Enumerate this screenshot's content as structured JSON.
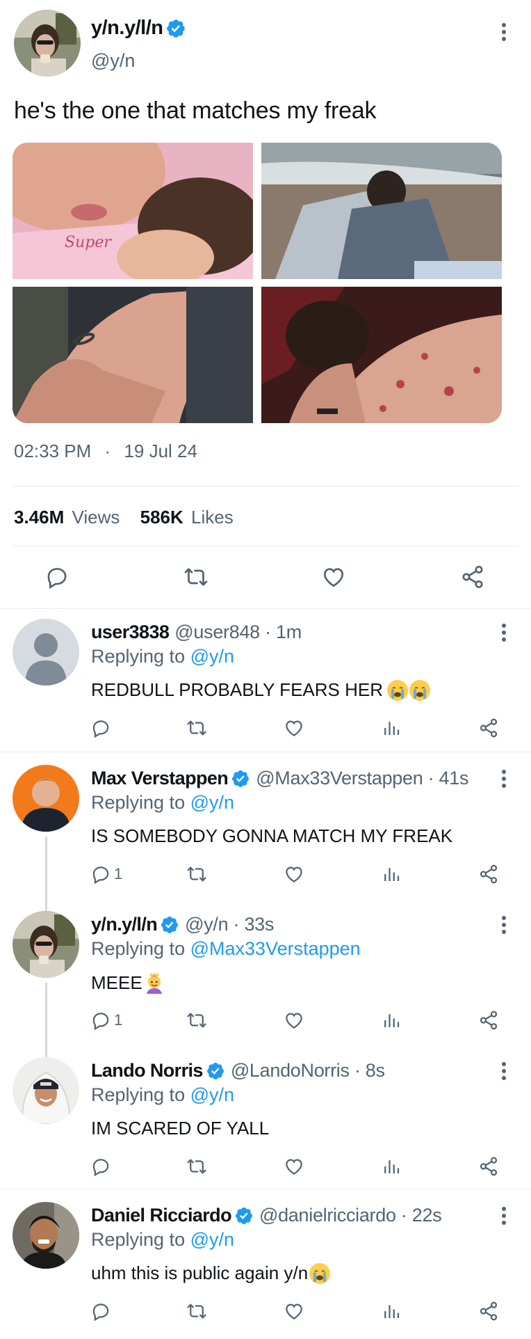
{
  "main_tweet": {
    "display_name": "y/n.y/l/n",
    "handle": "@y/n",
    "text": "he's the one that matches my freak",
    "time": "02:33 PM",
    "separator": "·",
    "date": "19 Jul 24",
    "views_count": "3.46M",
    "views_label": "Views",
    "likes_count": "586K",
    "likes_label": "Likes"
  },
  "replies": [
    {
      "display_name": "user3838",
      "handle": "@user848 · 1m",
      "replying_prefix": "Replying to",
      "replying_to": "@y/n",
      "text": "REDBULL PROBABLY FEARS HER",
      "reply_count": ""
    },
    {
      "display_name": "Max Verstappen",
      "handle": "@Max33Verstappen · 41s",
      "replying_prefix": "Replying to",
      "replying_to": "@y/n",
      "text": "IS SOMEBODY GONNA MATCH MY FREAK",
      "reply_count": "1"
    },
    {
      "display_name": "y/n.y/l/n",
      "handle": "@y/n · 33s",
      "replying_prefix": "Replying to",
      "replying_to": "@Max33Verstappen",
      "text": "MEEE",
      "reply_count": "1"
    },
    {
      "display_name": "Lando Norris",
      "handle": "@LandoNorris · 8s",
      "replying_prefix": "Replying to",
      "replying_to": "@y/n",
      "text": "IM SCARED OF YALL",
      "reply_count": ""
    },
    {
      "display_name": "Daniel Ricciardo",
      "handle": "@danielricciardo · 22s",
      "replying_prefix": "Replying to",
      "replying_to": "@y/n",
      "text": "uhm this is public again y/n",
      "reply_count": ""
    }
  ],
  "colors": {
    "link": "#1d9bf0",
    "secondary": "#536471",
    "primary_text": "#0f1419",
    "divider": "#e6ecf0"
  },
  "icons": [
    "verified-badge-icon",
    "more-icon",
    "reply-icon",
    "retweet-icon",
    "like-icon",
    "share-icon",
    "views-icon",
    "loudly-crying-face-emoji",
    "princess-emoji"
  ]
}
